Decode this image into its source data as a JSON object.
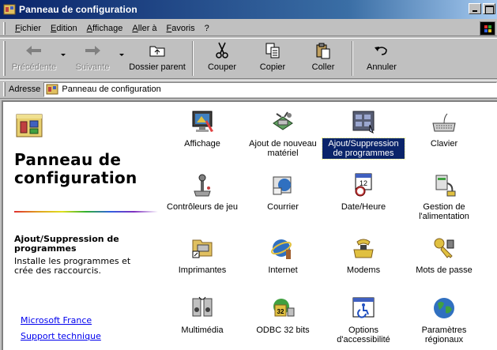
{
  "window": {
    "title": "Panneau de configuration"
  },
  "menu": [
    "Fichier",
    "Edition",
    "Affichage",
    "Aller à",
    "Favoris",
    "?"
  ],
  "toolbar": {
    "back": "Précédente",
    "forward": "Suivante",
    "parent": "Dossier parent",
    "cut": "Couper",
    "copy": "Copier",
    "paste": "Coller",
    "undo": "Annuler"
  },
  "address": {
    "label": "Adresse",
    "value": "Panneau de configuration"
  },
  "left_pane": {
    "title": "Panneau de configuration",
    "selected_title": "Ajout/Suppression de programmes",
    "selected_desc": "Installe les programmes et crée des raccourcis.",
    "links": [
      "Microsoft France",
      "Support technique"
    ]
  },
  "items": [
    {
      "label": "Affichage",
      "icon": "display-icon"
    },
    {
      "label": "Ajout de nouveau matériel",
      "icon": "add-hardware-icon"
    },
    {
      "label": "Ajout/Suppression de programmes",
      "icon": "add-remove-programs-icon",
      "selected": true
    },
    {
      "label": "Clavier",
      "icon": "keyboard-icon"
    },
    {
      "label": "Contrôleurs de jeu",
      "icon": "game-controller-icon"
    },
    {
      "label": "Courrier",
      "icon": "mail-icon"
    },
    {
      "label": "Date/Heure",
      "icon": "date-time-icon"
    },
    {
      "label": "Gestion de l'alimentation",
      "icon": "power-management-icon"
    },
    {
      "label": "Imprimantes",
      "icon": "printers-icon"
    },
    {
      "label": "Internet",
      "icon": "internet-icon"
    },
    {
      "label": "Modems",
      "icon": "modem-icon"
    },
    {
      "label": "Mots de passe",
      "icon": "passwords-icon"
    },
    {
      "label": "Multimédia",
      "icon": "multimedia-icon"
    },
    {
      "label": "ODBC 32 bits",
      "icon": "odbc-icon"
    },
    {
      "label": "Options d'accessibilité",
      "icon": "accessibility-icon"
    },
    {
      "label": "Paramètres régionaux",
      "icon": "regional-settings-icon"
    }
  ]
}
